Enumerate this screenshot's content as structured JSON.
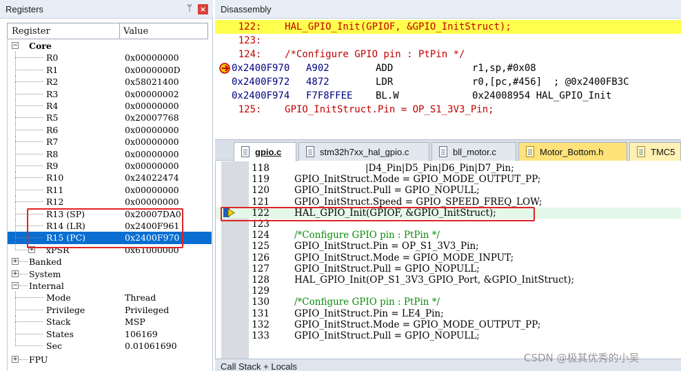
{
  "registers": {
    "title": "Registers",
    "pin_glyph": "ᛘ",
    "close_glyph": "×",
    "col_register": "Register",
    "col_value": "Value",
    "core_label": "Core",
    "rows": [
      {
        "name": "R0",
        "value": "0x00000000"
      },
      {
        "name": "R1",
        "value": "0x0000000D"
      },
      {
        "name": "R2",
        "value": "0x58021400"
      },
      {
        "name": "R3",
        "value": "0x00000002"
      },
      {
        "name": "R4",
        "value": "0x00000000"
      },
      {
        "name": "R5",
        "value": "0x20007768"
      },
      {
        "name": "R6",
        "value": "0x00000000"
      },
      {
        "name": "R7",
        "value": "0x00000000"
      },
      {
        "name": "R8",
        "value": "0x00000000"
      },
      {
        "name": "R9",
        "value": "0x00000000"
      },
      {
        "name": "R10",
        "value": "0x24022474"
      },
      {
        "name": "R11",
        "value": "0x00000000"
      },
      {
        "name": "R12",
        "value": "0x00000000"
      },
      {
        "name": "R13 (SP)",
        "value": "0x20007DA0"
      },
      {
        "name": "R14 (LR)",
        "value": "0x2400F961"
      },
      {
        "name": "R15 (PC)",
        "value": "0x2400F970"
      },
      {
        "name": "xPSR",
        "value": "0x61000000"
      }
    ],
    "groups": [
      "Banked",
      "System",
      "Internal"
    ],
    "internal_rows": [
      {
        "name": "Mode",
        "value": "Thread"
      },
      {
        "name": "Privilege",
        "value": "Privileged"
      },
      {
        "name": "Stack",
        "value": "MSP"
      },
      {
        "name": "States",
        "value": "106169"
      },
      {
        "name": "Sec",
        "value": "0.01061690"
      }
    ],
    "fpu_label": "FPU"
  },
  "disassembly": {
    "title": "Disassembly",
    "lines": [
      {
        "text": "    122:    HAL_GPIO_Init(GPIOF, &GPIO_InitStruct);",
        "kind": "src"
      },
      {
        "text": "    123:",
        "kind": "src"
      },
      {
        "text": "    124:    /*Configure GPIO pin : PtPin */",
        "kind": "src"
      },
      {
        "addr": "0x2400F970",
        "op": "A902",
        "mn": "ADD",
        "args": "r1,sp,#0x08",
        "kind": "asm"
      },
      {
        "addr": "0x2400F972",
        "op": "4872",
        "mn": "LDR",
        "args": "r0,[pc,#456]  ; @0x2400FB3C",
        "kind": "asm"
      },
      {
        "addr": "0x2400F974",
        "op": "F7F8FFEE",
        "mn": "BL.W",
        "args": "0x24008954 HAL_GPIO_Init",
        "kind": "asm"
      },
      {
        "text": "    125:    GPIO_InitStruct.Pin = OP_S1_3V3_Pin;",
        "kind": "src"
      }
    ]
  },
  "tabs": [
    {
      "label": "gpio.c"
    },
    {
      "label": "stm32h7xx_hal_gpio.c"
    },
    {
      "label": "bll_motor.c"
    },
    {
      "label": "Motor_Bottom.h"
    },
    {
      "label": "TMC5"
    }
  ],
  "editor": {
    "lines": [
      {
        "num": "118",
        "code": "                        |D4_Pin|D5_Pin|D6_Pin|D7_Pin;"
      },
      {
        "num": "119",
        "code": "GPIO_InitStruct.Mode = GPIO_MODE_OUTPUT_PP;"
      },
      {
        "num": "120",
        "code": "GPIO_InitStruct.Pull = GPIO_NOPULL;"
      },
      {
        "num": "121",
        "code": "GPIO_InitStruct.Speed = GPIO_SPEED_FREQ_LOW;"
      },
      {
        "num": "122",
        "code": "HAL_GPIO_Init(GPIOF, &GPIO_InitStruct);"
      },
      {
        "num": "123",
        "code": ""
      },
      {
        "num": "124",
        "code": "/*Configure GPIO pin : PtPin */"
      },
      {
        "num": "125",
        "code": "GPIO_InitStruct.Pin = OP_S1_3V3_Pin;"
      },
      {
        "num": "126",
        "code": "GPIO_InitStruct.Mode = GPIO_MODE_INPUT;"
      },
      {
        "num": "127",
        "code": "GPIO_InitStruct.Pull = GPIO_NOPULL;"
      },
      {
        "num": "128",
        "code": "HAL_GPIO_Init(OP_S1_3V3_GPIO_Port, &GPIO_InitStruct);"
      },
      {
        "num": "129",
        "code": ""
      },
      {
        "num": "130",
        "code": "/*Configure GPIO pin : PtPin */"
      },
      {
        "num": "131",
        "code": "GPIO_InitStruct.Pin = LE4_Pin;"
      },
      {
        "num": "132",
        "code": "GPIO_InitStruct.Mode = GPIO_MODE_OUTPUT_PP;"
      },
      {
        "num": "133",
        "code": "GPIO_InitStruct.Pull = GPIO_NOPULL;"
      }
    ]
  },
  "callstack": {
    "title": "Call Stack + Locals"
  },
  "watermark": "CSDN @极其优秀的小吴",
  "colors": {
    "highlight": "#ffff4d",
    "selection": "#0a6ed1",
    "annotation": "#e02424"
  }
}
